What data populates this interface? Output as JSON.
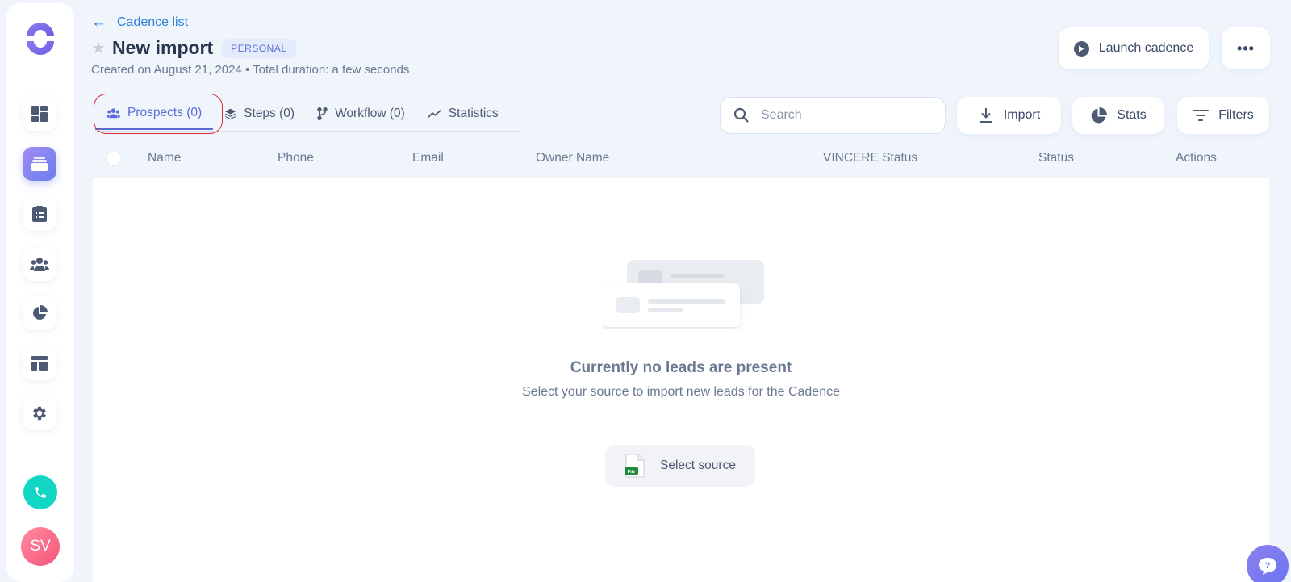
{
  "sidebar": {
    "nav_items": [
      {
        "icon": "dashboard-icon",
        "active": false
      },
      {
        "icon": "cadence-stack-icon",
        "active": true
      },
      {
        "icon": "tasks-clipboard-icon",
        "active": false
      },
      {
        "icon": "people-icon",
        "active": false
      },
      {
        "icon": "pie-chart-icon",
        "active": false
      },
      {
        "icon": "layout-template-icon",
        "active": false
      },
      {
        "icon": "gear-icon",
        "active": false
      }
    ],
    "avatar_initials": "SV",
    "accent": "#6a7ef0",
    "call_color": "#12d6c4"
  },
  "header": {
    "back_label": "Cadence list",
    "title": "New import",
    "badge": "PERSONAL",
    "subtitle": "Created on August 21, 2024 • Total duration: a few seconds",
    "launch_label": "Launch cadence",
    "more_label": "•••"
  },
  "tabs": [
    {
      "label": "Prospects (0)",
      "icon": "people-icon",
      "active": true
    },
    {
      "label": "Steps (0)",
      "icon": "layers-icon",
      "active": false
    },
    {
      "label": "Workflow (0)",
      "icon": "workflow-branch-icon",
      "active": false
    },
    {
      "label": "Statistics",
      "icon": "trend-line-icon",
      "active": false
    }
  ],
  "toolbar": {
    "search_placeholder": "Search",
    "import_label": "Import",
    "stats_label": "Stats",
    "filters_label": "Filters"
  },
  "table": {
    "columns": [
      "Name",
      "Phone",
      "Email",
      "Owner Name",
      "VINCERE Status",
      "Status",
      "Actions"
    ]
  },
  "empty_state": {
    "title": "Currently no leads are present",
    "subtitle": "Select your source to import new leads for the Cadence",
    "source_button": "Select source",
    "file_icon_label": "File"
  }
}
